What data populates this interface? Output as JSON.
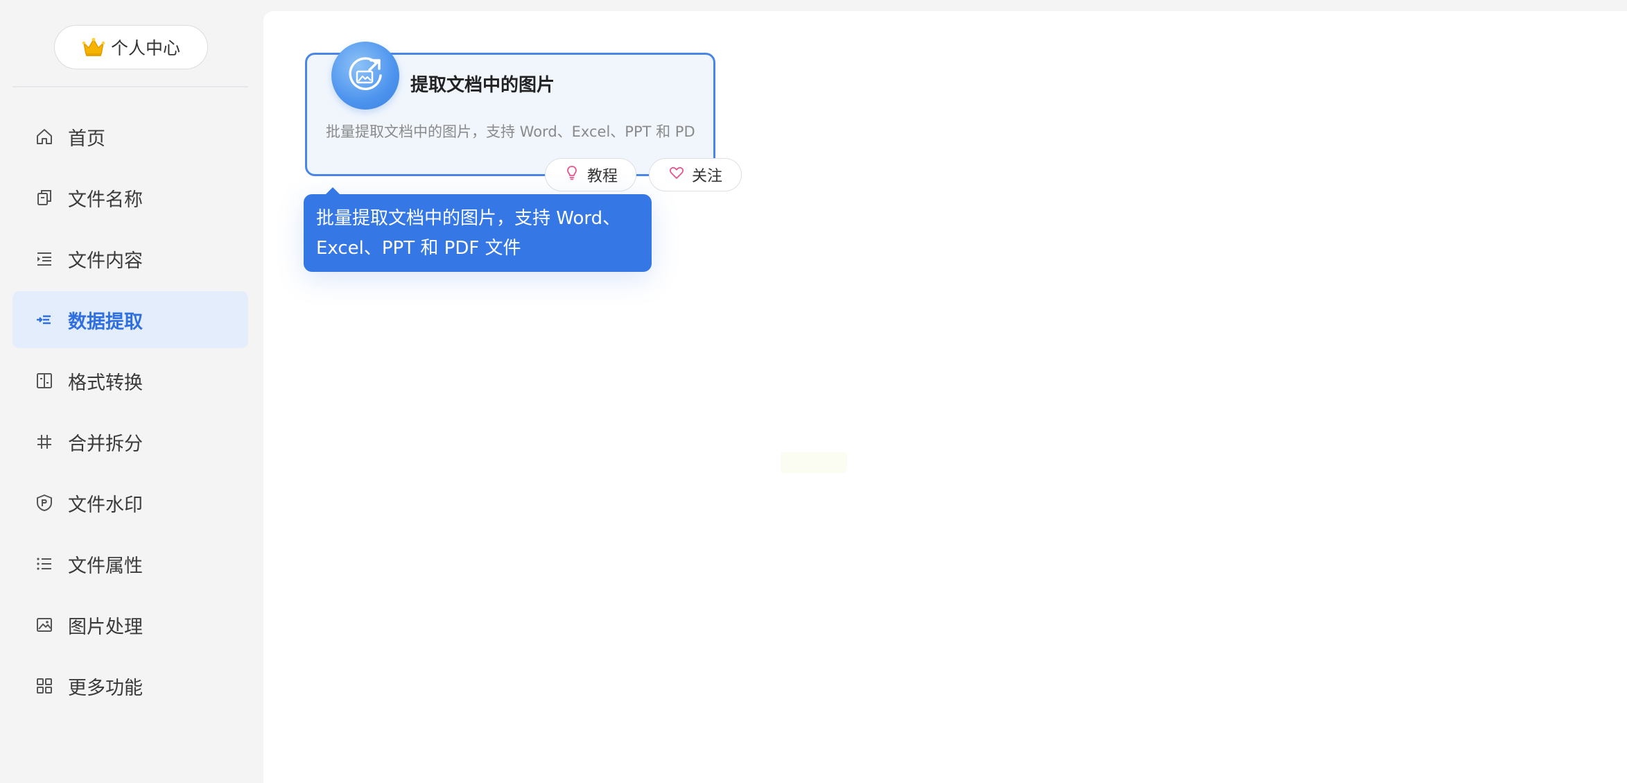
{
  "sidebar": {
    "personal_center": "个人中心",
    "items": [
      {
        "label": "首页",
        "icon": "home-icon"
      },
      {
        "label": "文件名称",
        "icon": "file-copy-icon"
      },
      {
        "label": "文件内容",
        "icon": "indent-list-icon"
      },
      {
        "label": "数据提取",
        "icon": "extract-icon",
        "active": true
      },
      {
        "label": "格式转换",
        "icon": "convert-frame-icon"
      },
      {
        "label": "合并拆分",
        "icon": "hash-icon"
      },
      {
        "label": "文件水印",
        "icon": "shield-watermark-icon"
      },
      {
        "label": "文件属性",
        "icon": "list-icon"
      },
      {
        "label": "图片处理",
        "icon": "image-icon"
      },
      {
        "label": "更多功能",
        "icon": "grid-icon"
      }
    ]
  },
  "tool_card": {
    "title": "提取文档中的图片",
    "description": "批量提取文档中的图片，支持 Word、Excel、PPT 和 PDF 文件",
    "icon": "image-export-icon",
    "tutorial_label": "教程",
    "follow_label": "关注"
  },
  "tooltip": {
    "line1": "批量提取文档中的图片，支持 Word、",
    "line2": "Excel、PPT 和 PDF 文件"
  },
  "colors": {
    "accent": "#2f6fe0",
    "active_bg": "#e3edfb",
    "tooltip_bg": "#3577e5",
    "card_border": "#4a86e8",
    "pink": "#e8568f"
  }
}
